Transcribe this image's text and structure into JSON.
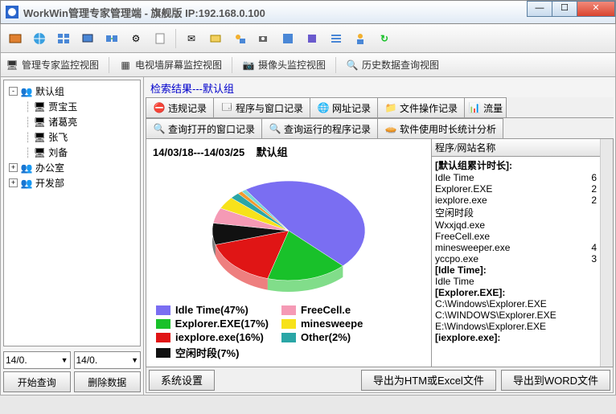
{
  "window": {
    "title": "WorkWin管理专家管理端 - 旗舰版 IP:192.168.0.100"
  },
  "viewtabs": {
    "v1": "管理专家监控视图",
    "v2": "电视墙屏幕监控视图",
    "v3": "摄像头监控视图",
    "v4": "历史数据查询视图"
  },
  "tree": {
    "root": "默认组",
    "u1": "贾宝玉",
    "u2": "诸葛亮",
    "u3": "张飞",
    "u4": "刘备",
    "g2": "办公室",
    "g3": "开发部"
  },
  "dates": {
    "from": "14/0.",
    "to": "14/0."
  },
  "leftbtns": {
    "start": "开始查询",
    "del": "删除数据"
  },
  "search_result": "检索结果---默认组",
  "tabs_row1": {
    "t1": "违规记录",
    "t2": "程序与窗口记录",
    "t3": "网址记录",
    "t4": "文件操作记录",
    "t5": "流量"
  },
  "tabs_row2": {
    "t1": "查询打开的窗口记录",
    "t2": "查询运行的程序记录",
    "t3": "软件使用时长统计分析"
  },
  "chart_header": {
    "range": "14/03/18---14/03/25",
    "group": "默认组"
  },
  "chart_data": {
    "type": "pie",
    "title": "",
    "series": [
      {
        "name": "Idle Time",
        "value": 47,
        "color": "#7a6ef2"
      },
      {
        "name": "Explorer.EXE",
        "value": 17,
        "color": "#19c12a"
      },
      {
        "name": "iexplore.exe",
        "value": 16,
        "color": "#e01515"
      },
      {
        "name": "空闲时段",
        "value": 7,
        "color": "#111111"
      },
      {
        "name": "FreeCell.exe",
        "value": 5,
        "color": "#f59ab5"
      },
      {
        "name": "minesweeper.exe",
        "value": 4,
        "color": "#f7e21a"
      },
      {
        "name": "Other",
        "value": 2,
        "color": "#2aa6a6"
      },
      {
        "name": "_gap1",
        "value": 1,
        "color": "#f29a2e"
      },
      {
        "name": "_gap2",
        "value": 1,
        "color": "#7ad6d6"
      }
    ],
    "legend": [
      {
        "label": "Idle Time(47%)",
        "color": "#7a6ef2"
      },
      {
        "label": "FreeCell.e",
        "color": "#f59ab5"
      },
      {
        "label": "Explorer.EXE(17%)",
        "color": "#19c12a"
      },
      {
        "label": "minesweepe",
        "color": "#f7e21a"
      },
      {
        "label": "iexplore.exe(16%)",
        "color": "#e01515"
      },
      {
        "label": "Other(2%)",
        "color": "#2aa6a6"
      },
      {
        "label": "空闲时段(7%)",
        "color": "#111111"
      }
    ]
  },
  "list": {
    "header": "程序/网站名称",
    "rows": [
      {
        "t": "[默认组累计时长]:",
        "v": ""
      },
      {
        "t": "Idle Time",
        "v": "6"
      },
      {
        "t": "Explorer.EXE",
        "v": "2"
      },
      {
        "t": "iexplore.exe",
        "v": "2"
      },
      {
        "t": "空闲时段",
        "v": ""
      },
      {
        "t": "Wxxjqd.exe",
        "v": ""
      },
      {
        "t": "FreeCell.exe",
        "v": ""
      },
      {
        "t": "minesweeper.exe",
        "v": "4"
      },
      {
        "t": "yccpo.exe",
        "v": "3"
      },
      {
        "t": "",
        "v": ""
      },
      {
        "t": "[Idle Time]:",
        "v": ""
      },
      {
        "t": "Idle Time",
        "v": ""
      },
      {
        "t": "",
        "v": ""
      },
      {
        "t": "[Explorer.EXE]:",
        "v": ""
      },
      {
        "t": "C:\\Windows\\Explorer.EXE",
        "v": ""
      },
      {
        "t": "C:\\WINDOWS\\Explorer.EXE",
        "v": ""
      },
      {
        "t": "E:\\Windows\\Explorer.EXE",
        "v": ""
      },
      {
        "t": "[iexplore.exe]:",
        "v": ""
      }
    ]
  },
  "bottom": {
    "sys": "系统设置",
    "export_html": "导出为HTM或Excel文件",
    "export_word": "导出到WORD文件"
  }
}
